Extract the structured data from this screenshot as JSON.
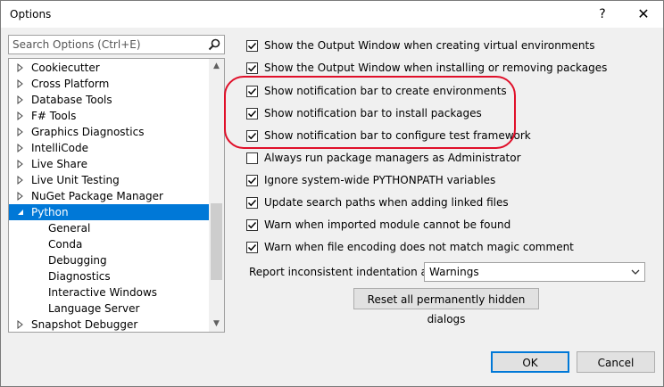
{
  "window": {
    "title": "Options",
    "help_glyph": "?",
    "close_glyph": "✕"
  },
  "search": {
    "placeholder": "Search Options (Ctrl+E)"
  },
  "tree": {
    "items": [
      {
        "label": "Cookiecutter",
        "level": 0,
        "expanded": false
      },
      {
        "label": "Cross Platform",
        "level": 0,
        "expanded": false
      },
      {
        "label": "Database Tools",
        "level": 0,
        "expanded": false
      },
      {
        "label": "F# Tools",
        "level": 0,
        "expanded": false
      },
      {
        "label": "Graphics Diagnostics",
        "level": 0,
        "expanded": false
      },
      {
        "label": "IntelliCode",
        "level": 0,
        "expanded": false
      },
      {
        "label": "Live Share",
        "level": 0,
        "expanded": false
      },
      {
        "label": "Live Unit Testing",
        "level": 0,
        "expanded": false
      },
      {
        "label": "NuGet Package Manager",
        "level": 0,
        "expanded": false
      },
      {
        "label": "Python",
        "level": 0,
        "expanded": true,
        "selected": true
      },
      {
        "label": "General",
        "level": 1
      },
      {
        "label": "Conda",
        "level": 1
      },
      {
        "label": "Debugging",
        "level": 1
      },
      {
        "label": "Diagnostics",
        "level": 1
      },
      {
        "label": "Interactive Windows",
        "level": 1
      },
      {
        "label": "Language Server",
        "level": 1
      },
      {
        "label": "Snapshot Debugger",
        "level": 0,
        "expanded": false
      }
    ]
  },
  "options": [
    {
      "label": "Show the Output Window when creating virtual environments",
      "checked": true
    },
    {
      "label": "Show the Output Window when installing or removing packages",
      "checked": true
    },
    {
      "label": "Show notification bar to create environments",
      "checked": true
    },
    {
      "label": "Show notification bar to install packages",
      "checked": true
    },
    {
      "label": "Show notification bar to configure test framework",
      "checked": true
    },
    {
      "label": "Always run package managers as Administrator",
      "checked": false
    },
    {
      "label": "Ignore system-wide PYTHONPATH variables",
      "checked": true
    },
    {
      "label": "Update search paths when adding linked files",
      "checked": true
    },
    {
      "label": "Warn when imported module cannot be found",
      "checked": true
    },
    {
      "label": "Warn when file encoding does not match magic comment",
      "checked": true
    }
  ],
  "indentation": {
    "label": "Report inconsistent indentation as",
    "value": "Warnings"
  },
  "buttons": {
    "reset": "Reset all permanently hidden dialogs",
    "ok": "OK",
    "cancel": "Cancel"
  },
  "colors": {
    "selection": "#0078d7",
    "highlight_ring": "#e0102a"
  }
}
